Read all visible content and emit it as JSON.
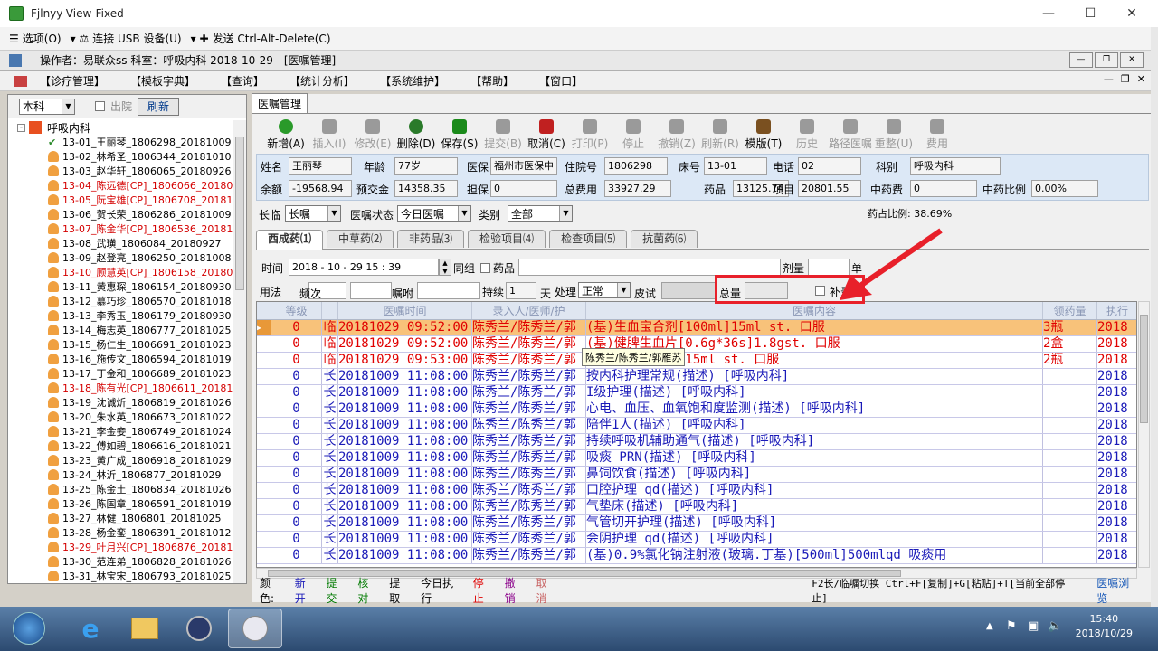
{
  "window": {
    "title": "Fjlnyy-View-Fixed"
  },
  "rdp": {
    "options": "选项(O)",
    "usb": "连接 USB 设备(U)",
    "cad": "发送 Ctrl-Alt-Delete(C)"
  },
  "opbar": {
    "text": "操作者：易联众ss  科室：呼吸内科  2018-10-29 - [医嘱管理]"
  },
  "menu": [
    "【诊疗管理】",
    "【模板字典】",
    "【查询】",
    "【统计分析】",
    "【系统维护】",
    "【帮助】",
    "【窗口】"
  ],
  "left": {
    "scope": "本科",
    "discharged": "出院",
    "refresh": "刷新",
    "root": "呼吸内科",
    "patients": [
      {
        "t": "13-01_王丽琴_1806298_20181009",
        "r": false
      },
      {
        "t": "13-02_林希圣_1806344_20181010",
        "r": false
      },
      {
        "t": "13-03_赵华轩_1806065_20180926",
        "r": false
      },
      {
        "t": "13-04_陈远德[CP]_1806066_20180",
        "r": true
      },
      {
        "t": "13-05_阮宝雄[CP]_1806708_20181",
        "r": true
      },
      {
        "t": "13-06_贺长荣_1806286_20181009",
        "r": false
      },
      {
        "t": "13-07_陈金华[CP]_1806536_20181",
        "r": true
      },
      {
        "t": "13-08_武璜_1806084_20180927",
        "r": false
      },
      {
        "t": "13-09_赵登亮_1806250_20181008",
        "r": false
      },
      {
        "t": "13-10_顾慧英[CP]_1806158_20180",
        "r": true
      },
      {
        "t": "13-11_黄惠琛_1806154_20180930",
        "r": false
      },
      {
        "t": "13-12_慕巧珍_1806570_20181018",
        "r": false
      },
      {
        "t": "13-13_李秀玉_1806179_20180930",
        "r": false
      },
      {
        "t": "13-14_梅志英_1806777_20181025",
        "r": false
      },
      {
        "t": "13-15_杨仁生_1806691_20181023",
        "r": false
      },
      {
        "t": "13-16_施传文_1806594_20181019",
        "r": false
      },
      {
        "t": "13-17_丁金和_1806689_20181023",
        "r": false
      },
      {
        "t": "13-18_陈有光[CP]_1806611_20181",
        "r": true
      },
      {
        "t": "13-19_沈诚炘_1806819_20181026",
        "r": false
      },
      {
        "t": "13-20_朱水英_1806673_20181022",
        "r": false
      },
      {
        "t": "13-21_李金妾_1806749_20181024",
        "r": false
      },
      {
        "t": "13-22_傅如碧_1806616_20181021",
        "r": false
      },
      {
        "t": "13-23_黄广成_1806918_20181029",
        "r": false
      },
      {
        "t": "13-24_林沂_1806877_20181029",
        "r": false
      },
      {
        "t": "13-25_陈金土_1806834_20181026",
        "r": false
      },
      {
        "t": "13-26_陈国章_1806591_20181019",
        "r": false
      },
      {
        "t": "13-27_林健_1806801_20181025",
        "r": false
      },
      {
        "t": "13-28_杨金銮_1806391_20181012",
        "r": false
      },
      {
        "t": "13-29_叶月兴[CP]_1806876_20181",
        "r": true
      },
      {
        "t": "13-30_范连弟_1806828_20181026",
        "r": false
      },
      {
        "t": "13-31_林宝宋_1806793_20181025",
        "r": false
      }
    ]
  },
  "tab": "医嘱管理",
  "toolbar": [
    {
      "l": "新增(A)",
      "c": "#2a9a2a",
      "d": false
    },
    {
      "l": "插入(I)",
      "c": "#9a9a9a",
      "d": true
    },
    {
      "l": "修改(E)",
      "c": "#9a9a9a",
      "d": true
    },
    {
      "l": "删除(D)",
      "c": "#2a7a2a",
      "d": false
    },
    {
      "l": "保存(S)",
      "c": "#1a8a1a",
      "d": false
    },
    {
      "l": "提交(B)",
      "c": "#9a9a9a",
      "d": true
    },
    {
      "l": "取消(C)",
      "c": "#c02020",
      "d": false
    },
    {
      "l": "打印(P)",
      "c": "#9a9a9a",
      "d": true
    },
    {
      "l": "停止",
      "c": "#9a9a9a",
      "d": true
    },
    {
      "l": "撤销(Z)",
      "c": "#9a9a9a",
      "d": true
    },
    {
      "l": "刷新(R)",
      "c": "#9a9a9a",
      "d": true
    },
    {
      "l": "模版(T)",
      "c": "#7a5020",
      "d": false
    },
    {
      "l": "历史",
      "c": "#9a9a9a",
      "d": true
    },
    {
      "l": "路径医嘱",
      "c": "#9a9a9a",
      "d": true
    },
    {
      "l": "重整(U)",
      "c": "#9a9a9a",
      "d": true
    },
    {
      "l": "费用",
      "c": "#9a9a9a",
      "d": true
    }
  ],
  "info": {
    "name_l": "姓名",
    "name": "王丽琴",
    "age_l": "年龄",
    "age": "77岁",
    "ins_l": "医保",
    "ins": "福州市医保中",
    "adm_l": "住院号",
    "adm": "1806298",
    "bed_l": "床号",
    "bed": "13-01",
    "tel_l": "电话",
    "tel": "02",
    "dept_l": "科别",
    "dept": "呼吸内科",
    "bal_l": "余额",
    "bal": "-19568.94",
    "dep_l": "预交金",
    "dep": "14358.35",
    "gua_l": "担保",
    "gua": "0",
    "tot_l": "总费用",
    "tot": "33927.29",
    "drug_l": "药品",
    "drug": "13125.74",
    "item_l": "项目",
    "item": "20801.55",
    "tcm_l": "中药费",
    "tcm": "0",
    "tcmr_l": "中药比例",
    "tcmr": "0.00%"
  },
  "filters": {
    "type_l": "长临",
    "type": "长嘱",
    "status_l": "医嘱状态",
    "status": "今日医嘱",
    "cat_l": "类别",
    "cat": "全部",
    "ratio": "药占比例: 38.69%"
  },
  "subtabs": [
    "西成药⑴",
    "中草药⑵",
    "非药品⑶",
    "检验项目⑷",
    "检查项目⑸",
    "抗菌药⑹"
  ],
  "entry": {
    "time_l": "时间",
    "time": "2018 - 10 - 29   15 : 39",
    "group": "同组",
    "drug": "药品",
    "dose_l": "剂量",
    "unit": "单",
    "usage_l": "用法",
    "freq_l": "频次",
    "note_l": "嘱咐",
    "cont_l": "持续",
    "cont": "1",
    "day": "天",
    "proc_l": "处理",
    "proc": "正常",
    "skin_l": "皮试",
    "total_l": "总量",
    "supp": "补录"
  },
  "grid": {
    "headers": [
      "等级",
      "",
      "医嘱时间",
      "录入人/医师/护",
      "医嘱内容",
      "领药量",
      "执行"
    ],
    "rows": [
      {
        "lv": "0",
        "k": "临",
        "t": "20181029 09:52:00",
        "p": "陈秀兰/陈秀兰/郭",
        "c": "(基)生血宝合剂[100ml]15ml st. 口服",
        "q": "3瓶",
        "e": "2018",
        "s": "sel"
      },
      {
        "lv": "0",
        "k": "临",
        "t": "20181029 09:52:00",
        "p": "陈秀兰/陈秀兰/郭",
        "c": "(基)健脾生血片[0.6g*36s]1.8gst. 口服",
        "q": "2盒",
        "e": "2018",
        "s": "temp"
      },
      {
        "lv": "0",
        "k": "临",
        "t": "20181029 09:53:00",
        "p": "陈秀兰/陈秀兰/郭",
        "c": "               无糖型)[330ml]15ml st. 口服",
        "q": "2瓶",
        "e": "2018",
        "s": "temp"
      },
      {
        "lv": "0",
        "k": "长",
        "t": "20181009 11:08:00",
        "p": "陈秀兰/陈秀兰/郭",
        "c": "按内科护理常规(描述)  [呼吸内科]",
        "q": "",
        "e": "2018",
        "s": ""
      },
      {
        "lv": "0",
        "k": "长",
        "t": "20181009 11:08:00",
        "p": "陈秀兰/陈秀兰/郭",
        "c": "I级护理(描述)  [呼吸内科]",
        "q": "",
        "e": "2018",
        "s": ""
      },
      {
        "lv": "0",
        "k": "长",
        "t": "20181009 11:08:00",
        "p": "陈秀兰/陈秀兰/郭",
        "c": "心电、血压、血氧饱和度监测(描述)  [呼吸内科]",
        "q": "",
        "e": "2018",
        "s": ""
      },
      {
        "lv": "0",
        "k": "长",
        "t": "20181009 11:08:00",
        "p": "陈秀兰/陈秀兰/郭",
        "c": "陪伴1人(描述)  [呼吸内科]",
        "q": "",
        "e": "2018",
        "s": ""
      },
      {
        "lv": "0",
        "k": "长",
        "t": "20181009 11:08:00",
        "p": "陈秀兰/陈秀兰/郭",
        "c": "持续呼吸机辅助通气(描述)  [呼吸内科]",
        "q": "",
        "e": "2018",
        "s": ""
      },
      {
        "lv": "0",
        "k": "长",
        "t": "20181009 11:08:00",
        "p": "陈秀兰/陈秀兰/郭",
        "c": "吸痰 PRN(描述)  [呼吸内科]",
        "q": "",
        "e": "2018",
        "s": ""
      },
      {
        "lv": "0",
        "k": "长",
        "t": "20181009 11:08:00",
        "p": "陈秀兰/陈秀兰/郭",
        "c": "鼻饲饮食(描述)  [呼吸内科]",
        "q": "",
        "e": "2018",
        "s": ""
      },
      {
        "lv": "0",
        "k": "长",
        "t": "20181009 11:08:00",
        "p": "陈秀兰/陈秀兰/郭",
        "c": "口腔护理 qd(描述)  [呼吸内科]",
        "q": "",
        "e": "2018",
        "s": ""
      },
      {
        "lv": "0",
        "k": "长",
        "t": "20181009 11:08:00",
        "p": "陈秀兰/陈秀兰/郭",
        "c": "气垫床(描述)  [呼吸内科]",
        "q": "",
        "e": "2018",
        "s": ""
      },
      {
        "lv": "0",
        "k": "长",
        "t": "20181009 11:08:00",
        "p": "陈秀兰/陈秀兰/郭",
        "c": "气管切开护理(描述)  [呼吸内科]",
        "q": "",
        "e": "2018",
        "s": ""
      },
      {
        "lv": "0",
        "k": "长",
        "t": "20181009 11:08:00",
        "p": "陈秀兰/陈秀兰/郭",
        "c": "会阴护理 qd(描述)  [呼吸内科]",
        "q": "",
        "e": "2018",
        "s": ""
      },
      {
        "lv": "0",
        "k": "长",
        "t": "20181009 11:08:00",
        "p": "陈秀兰/陈秀兰/郭",
        "c": "(基)0.9%氯化钠注射液(玻璃.丁基)[500ml]500mlqd 吸痰用",
        "q": "",
        "e": "2018",
        "s": ""
      }
    ]
  },
  "tooltip": "陈秀兰/陈秀兰/郭雁苏",
  "legend": {
    "label": "颜色:",
    "items": [
      {
        "t": "新开",
        "c": "#1a1ab8"
      },
      {
        "t": "提交",
        "c": "#007a00"
      },
      {
        "t": "核对",
        "c": "#007a00"
      },
      {
        "t": "提取",
        "c": "#000000"
      },
      {
        "t": "今日执行",
        "c": "#000000"
      },
      {
        "t": "停止",
        "c": "#e00000"
      },
      {
        "t": "撤销",
        "c": "#8a008a"
      },
      {
        "t": "取消",
        "c": "#c86464"
      }
    ],
    "hint": "F2长/临嘱切换 Ctrl+F[复制]+G[粘贴]+T[当前全部停止]",
    "browse": "医嘱浏览"
  },
  "clock": {
    "time": "15:40",
    "date": "2018/10/29"
  }
}
